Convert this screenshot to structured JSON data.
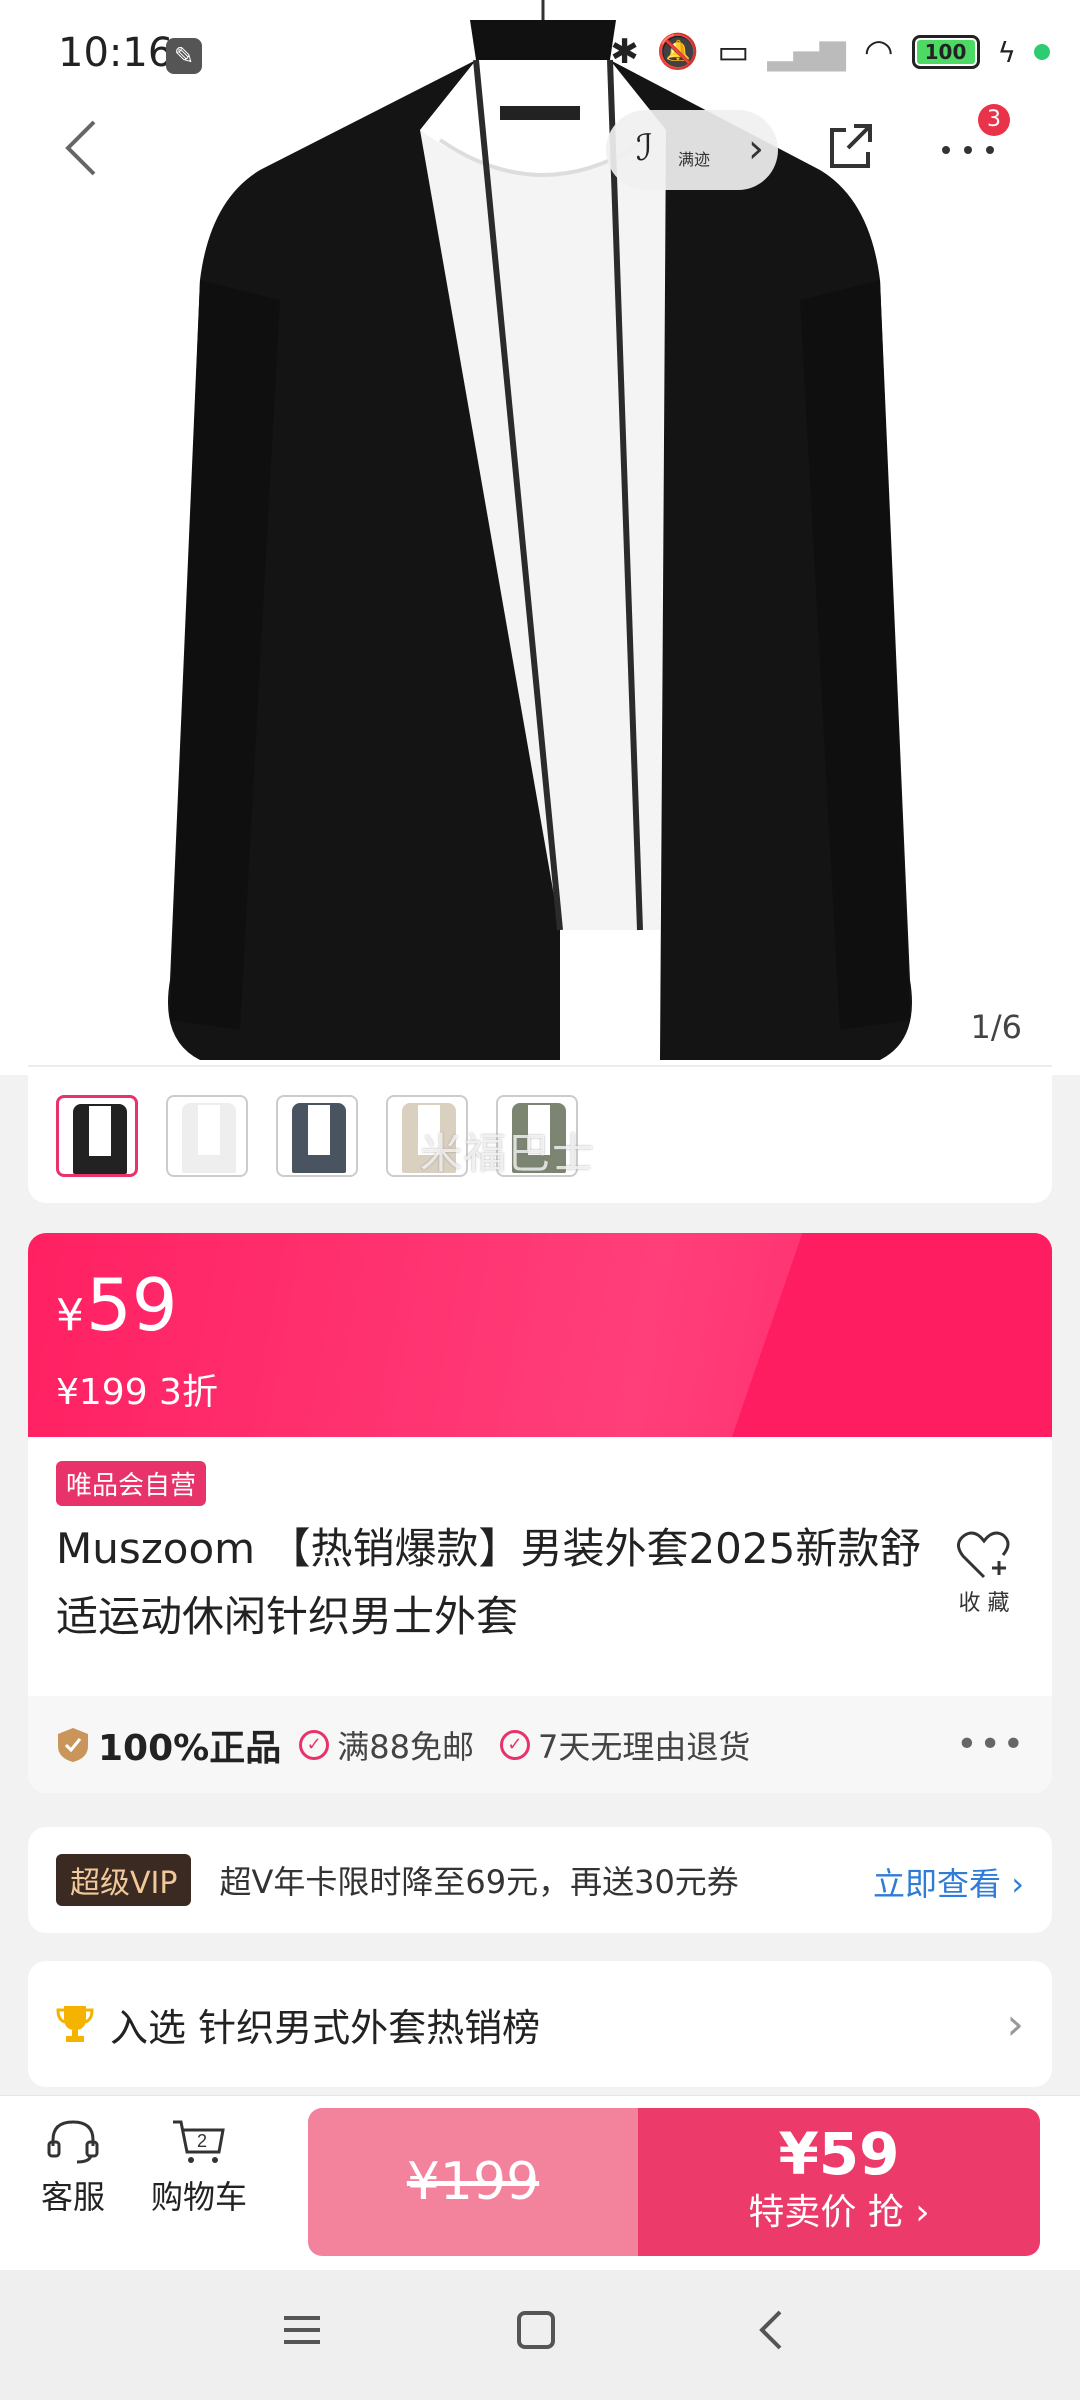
{
  "status": {
    "time": "10:16",
    "battery": "100"
  },
  "header": {
    "store_label": "满迹",
    "notification_count": "3"
  },
  "gallery": {
    "counter": "1/6",
    "watermark": "米福巴士"
  },
  "price": {
    "current_symbol": "¥",
    "current": "59",
    "original_line": "¥199  3折"
  },
  "product": {
    "self_operated_badge": "唯品会自营",
    "title": "Muszoom 【热销爆款】男装外套2025新款舒适运动休闲针织男士外套",
    "favorite_label": "收 藏"
  },
  "assurance": {
    "genuine": "100%正品",
    "free_shipping": "满88免邮",
    "returns": "7天无理由退货"
  },
  "vip": {
    "tag": "超级VIP",
    "text": "超Ⅴ年卡限时降至69元，再送30元券",
    "link": "立即查看"
  },
  "rank": {
    "text": "入选 针织男式外套热销榜"
  },
  "bottom": {
    "service_label": "客服",
    "cart_label": "购物车",
    "cart_count": "2",
    "original_price": "¥199",
    "special_price": "¥59",
    "buy_label": "特卖价 抢 ›"
  },
  "colors": {
    "accent": "#e8336a",
    "banner": "#ff2062",
    "link": "#2f7cd6"
  },
  "thumbnails": [
    {
      "name": "black",
      "color": "#222222"
    },
    {
      "name": "white",
      "color": "#eeeeee"
    },
    {
      "name": "grey-blue",
      "color": "#4a5360"
    },
    {
      "name": "beige",
      "color": "#d9d0c0"
    },
    {
      "name": "olive",
      "color": "#7c8571"
    }
  ]
}
